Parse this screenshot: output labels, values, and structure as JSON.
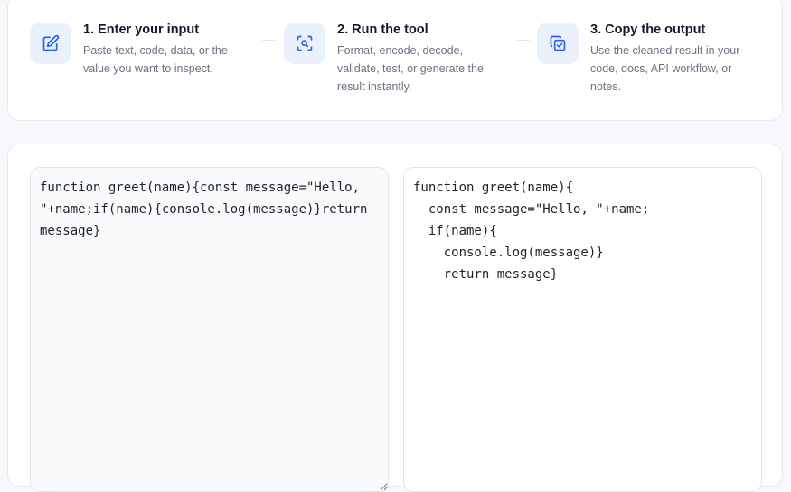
{
  "steps": [
    {
      "title": "1. Enter your input",
      "description": "Paste text, code, data, or the value you want to inspect.",
      "icon": "edit-icon"
    },
    {
      "title": "2. Run the tool",
      "description": "Format, encode, decode, validate, test, or generate the result instantly.",
      "icon": "search-scan-icon"
    },
    {
      "title": "3. Copy the output",
      "description": "Use the cleaned result in your code, docs, API workflow, or notes.",
      "icon": "copy-check-icon"
    }
  ],
  "editor": {
    "input_code": "function greet(name){const message=\"Hello, \"+name;if(name){console.log(message)}return message}",
    "output_code": "function greet(name){\n  const message=\"Hello, \"+name;\n  if(name){\n    console.log(message)}\n    return message}"
  },
  "colors": {
    "accent": "#2563eb",
    "icon_bg": "#eaf1fd",
    "title": "#111827",
    "muted": "#6b7280"
  }
}
